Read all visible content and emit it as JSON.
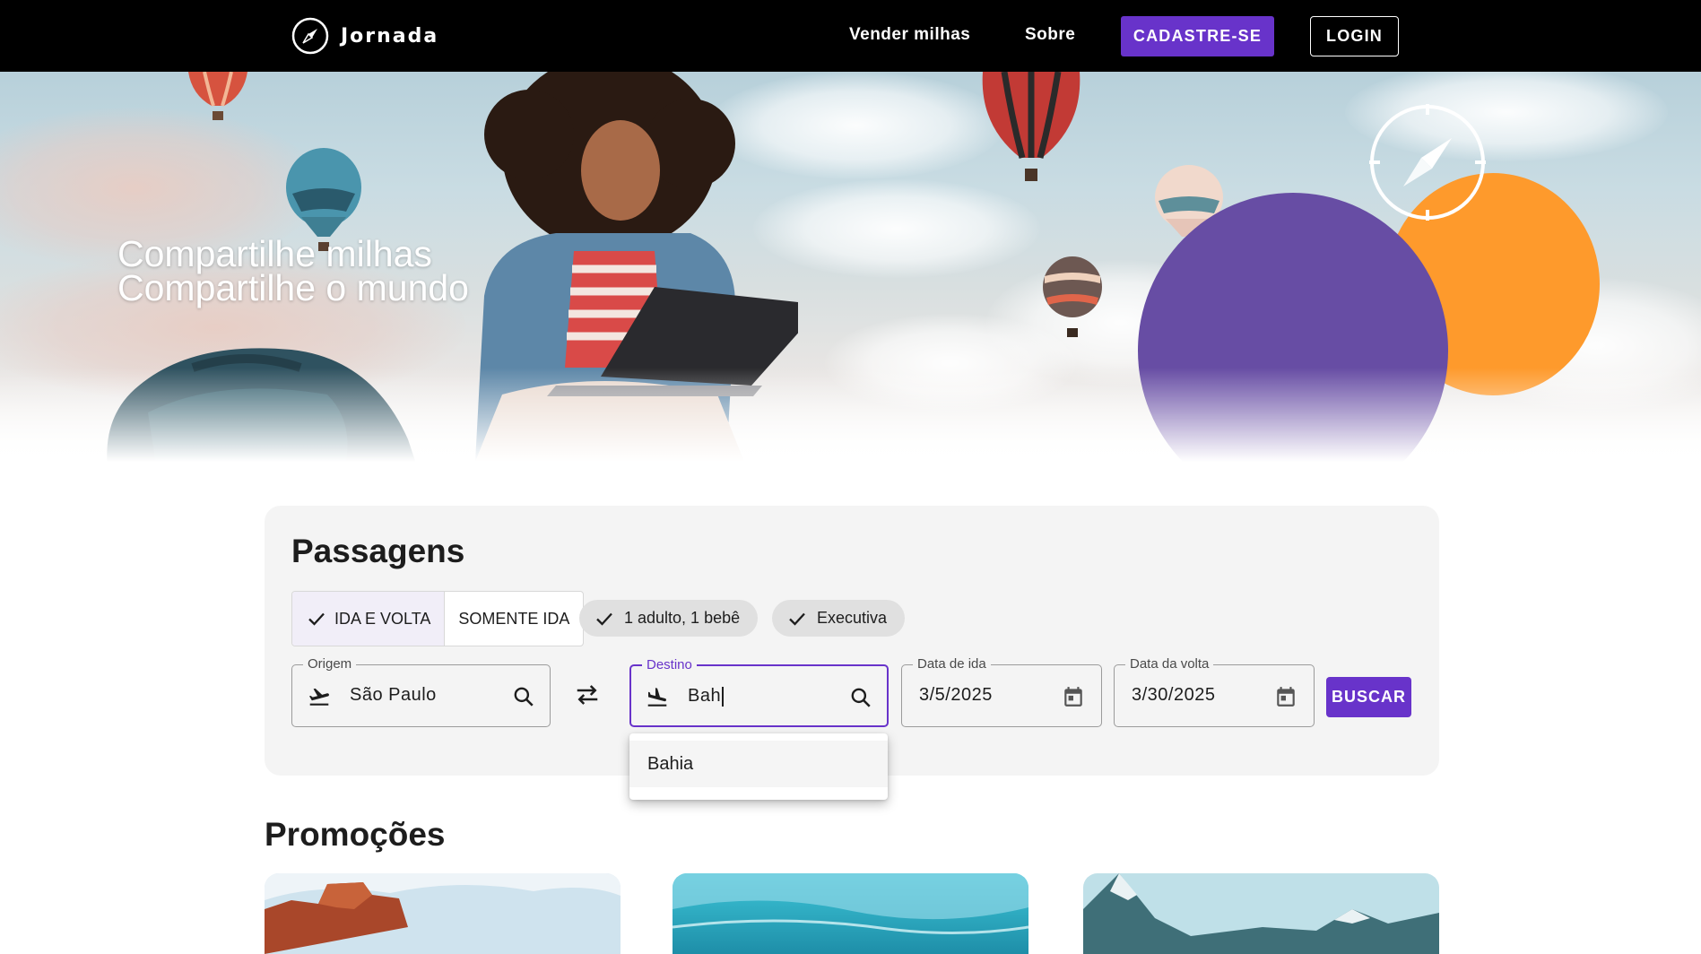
{
  "header": {
    "brand": "Jornada",
    "nav": {
      "sell_miles": "Vender milhas",
      "about": "Sobre"
    },
    "signup_label": "CADASTRE-SE",
    "login_label": "LOGIN"
  },
  "hero": {
    "line1": "Compartilhe milhas",
    "line2": "Compartilhe o mundo"
  },
  "search": {
    "title": "Passagens",
    "trip_types": [
      {
        "label": "IDA E VOLTA",
        "selected": true
      },
      {
        "label": "SOMENTE IDA",
        "selected": false
      }
    ],
    "passengers_label": "1 adulto, 1 bebê",
    "class_label": "Executiva",
    "origin": {
      "label": "Origem",
      "value": "São Paulo"
    },
    "destination": {
      "label": "Destino",
      "value": "Bah"
    },
    "departure": {
      "label": "Data de ida",
      "value": "3/5/2025"
    },
    "return": {
      "label": "Data da volta",
      "value": "3/30/2025"
    },
    "submit_label": "BUSCAR",
    "suggestions": [
      "Bahia"
    ]
  },
  "promotions": {
    "title": "Promoções"
  },
  "colors": {
    "accent": "#6833ca",
    "hero_purple": "#674da4",
    "hero_orange": "#fe9a2c",
    "header_bg": "#000000",
    "card_bg": "#f4f4f4"
  },
  "icons": [
    "compass-icon",
    "check-icon",
    "flight-takeoff-icon",
    "flight-land-icon",
    "search-icon",
    "swap-icon",
    "calendar-icon"
  ]
}
